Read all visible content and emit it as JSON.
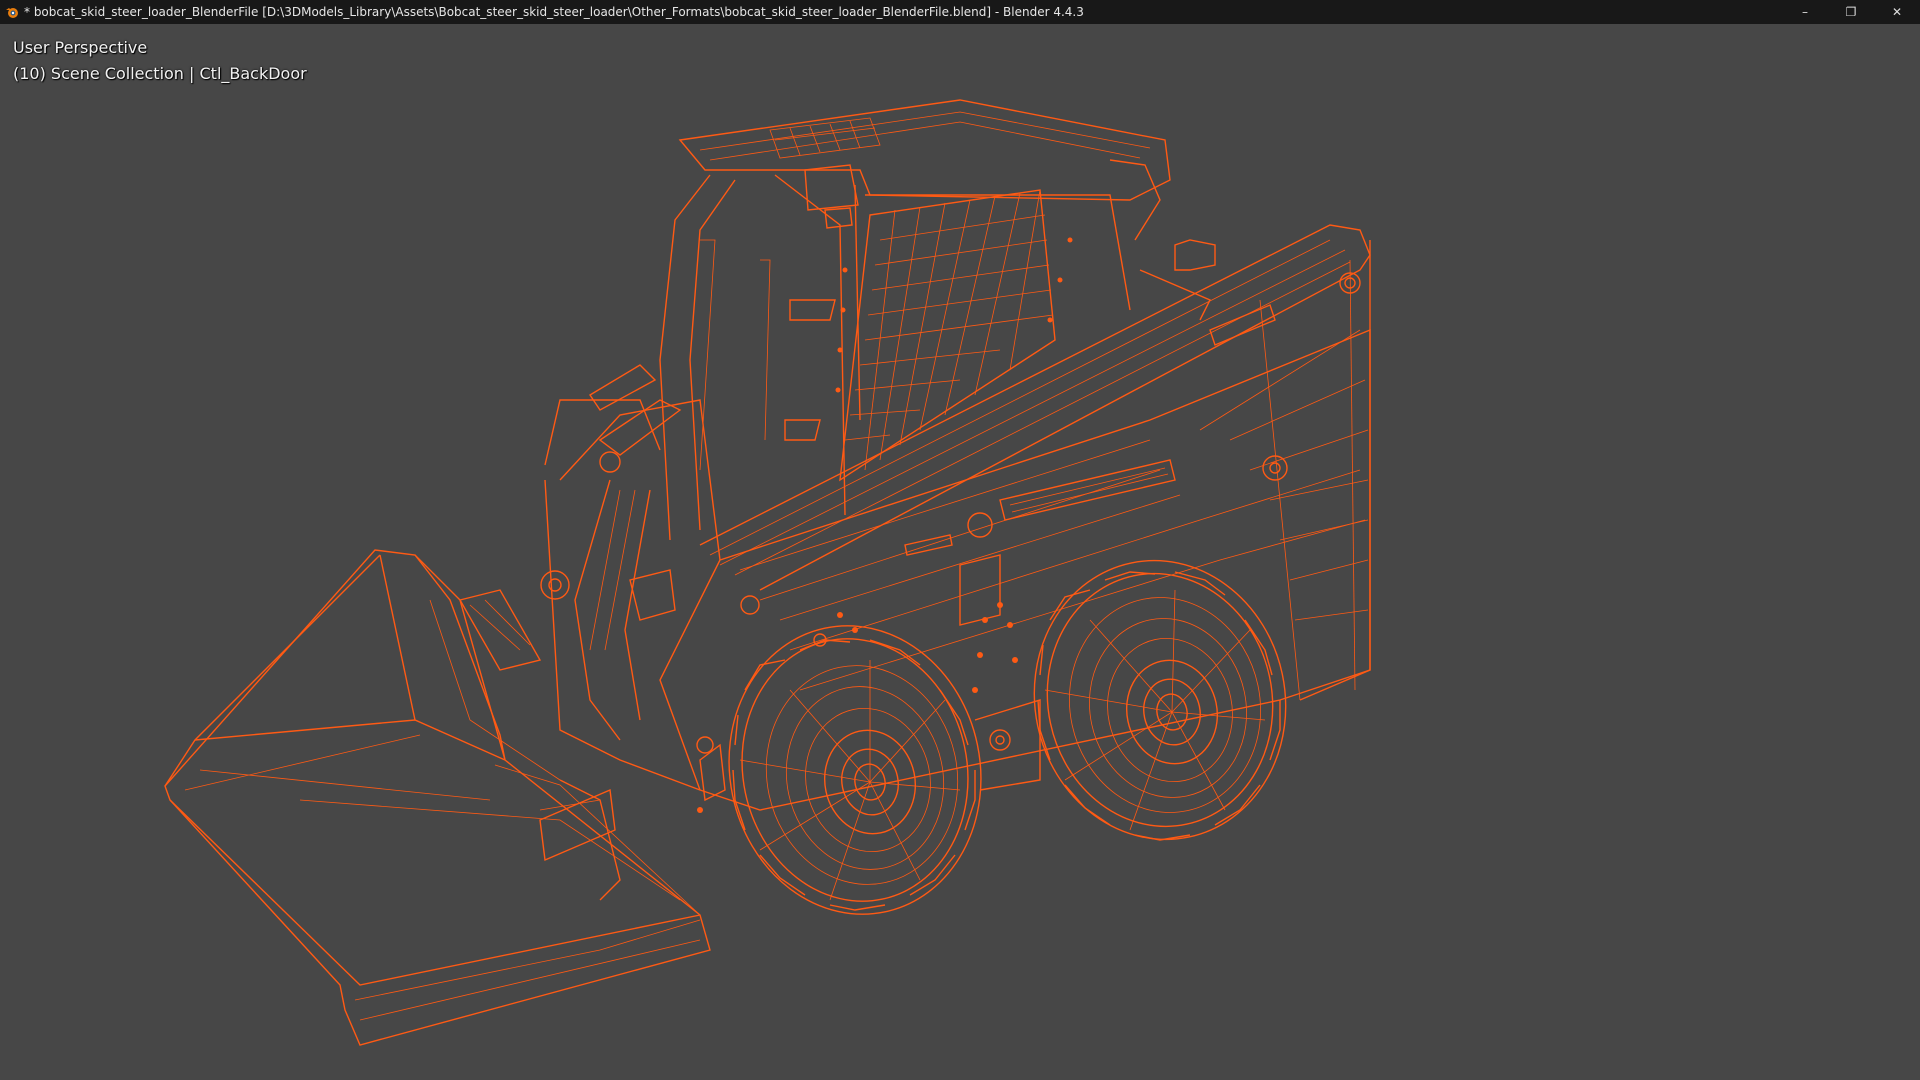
{
  "window": {
    "title": "* bobcat_skid_steer_loader_BlenderFile [D:\\3DModels_Library\\Assets\\Bobcat_steer_skid_steer_loader\\Other_Formats\\bobcat_skid_steer_loader_BlenderFile.blend] - Blender 4.4.3",
    "controls": {
      "minimize": "–",
      "restore": "❐",
      "close": "✕"
    }
  },
  "viewport": {
    "view_name": "User Perspective",
    "collection_info": "(10) Scene Collection | Ctl_BackDoor",
    "shading": "wireframe",
    "background_color": "#474747",
    "wire_color": "#ff5a14"
  }
}
